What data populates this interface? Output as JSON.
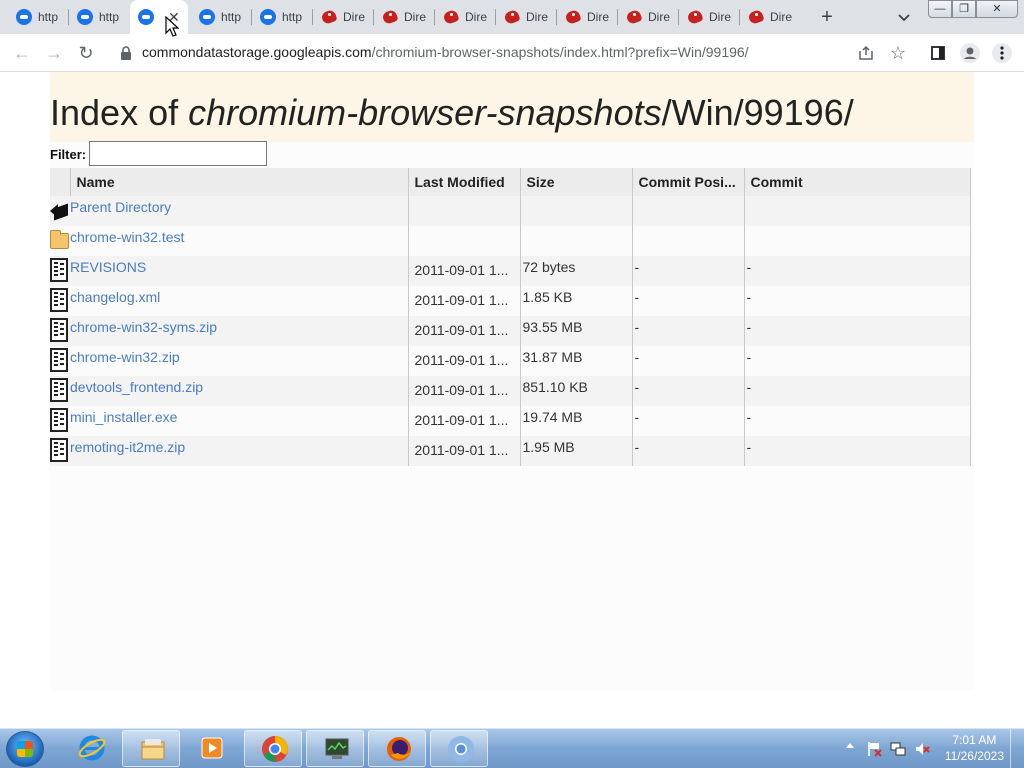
{
  "browser": {
    "tabs": [
      {
        "label": "http",
        "favicon": "generic-page-icon"
      },
      {
        "label": "http",
        "favicon": "generic-page-icon"
      },
      {
        "label": "",
        "favicon": "generic-page-icon",
        "active": true
      },
      {
        "label": "http",
        "favicon": "generic-page-icon"
      },
      {
        "label": "http",
        "favicon": "generic-page-icon"
      },
      {
        "label": "Dire",
        "favicon": "directory-logo-icon"
      },
      {
        "label": "Dire",
        "favicon": "directory-logo-icon"
      },
      {
        "label": "Dire",
        "favicon": "directory-logo-icon"
      },
      {
        "label": "Dire",
        "favicon": "directory-logo-icon"
      },
      {
        "label": "Dire",
        "favicon": "directory-logo-icon"
      },
      {
        "label": "Dire",
        "favicon": "directory-logo-icon"
      },
      {
        "label": "Dire",
        "favicon": "directory-logo-icon"
      },
      {
        "label": "Dire",
        "favicon": "directory-logo-icon"
      }
    ],
    "close_glyph": "✕",
    "newtab_glyph": "+",
    "url_host": "commondatastorage.googleapis.com",
    "url_path": "/chromium-browser-snapshots/index.html?prefix=Win/99196/"
  },
  "page": {
    "title_prefix": "Index of ",
    "title_italic": "chromium-browser-snapshots",
    "title_suffix": "/Win/99196/",
    "filter_label": "Filter:",
    "filter_value": "",
    "columns": [
      "Name",
      "Last Modified",
      "Size",
      "Commit Posi...",
      "Commit"
    ],
    "rows": [
      {
        "icon": "back",
        "name": "Parent Directory",
        "modified": "",
        "size": "",
        "commit_pos": "",
        "commit": ""
      },
      {
        "icon": "folder",
        "name": "chrome-win32.test",
        "modified": "",
        "size": "",
        "commit_pos": "",
        "commit": ""
      },
      {
        "icon": "file",
        "name": "REVISIONS",
        "modified": "2011-09-01 1...",
        "size": "72 bytes",
        "commit_pos": "-",
        "commit": "-"
      },
      {
        "icon": "file",
        "name": "changelog.xml",
        "modified": "2011-09-01 1...",
        "size": "1.85 KB",
        "commit_pos": "-",
        "commit": "-"
      },
      {
        "icon": "file",
        "name": "chrome-win32-syms.zip",
        "modified": "2011-09-01 1...",
        "size": "93.55 MB",
        "commit_pos": "-",
        "commit": "-"
      },
      {
        "icon": "file",
        "name": "chrome-win32.zip",
        "modified": "2011-09-01 1...",
        "size": "31.87 MB",
        "commit_pos": "-",
        "commit": "-"
      },
      {
        "icon": "file",
        "name": "devtools_frontend.zip",
        "modified": "2011-09-01 1...",
        "size": "851.10 KB",
        "commit_pos": "-",
        "commit": "-"
      },
      {
        "icon": "file",
        "name": "mini_installer.exe",
        "modified": "2011-09-01 1...",
        "size": "19.74 MB",
        "commit_pos": "-",
        "commit": "-"
      },
      {
        "icon": "file",
        "name": "remoting-it2me.zip",
        "modified": "2011-09-01 1...",
        "size": "1.95 MB",
        "commit_pos": "-",
        "commit": "-"
      }
    ]
  },
  "taskbar": {
    "apps": [
      "start-button",
      "internet-explorer-icon",
      "file-explorer-icon",
      "media-player-icon",
      "chrome-icon",
      "task-manager-icon",
      "firefox-icon",
      "chromium-icon"
    ],
    "clock_time": "7:01 AM",
    "clock_date": "11/26/2023"
  },
  "colors": {
    "link": "#4a7cc4",
    "tab_strip": "#dee1e6",
    "header_band": "#fdf6e6"
  }
}
